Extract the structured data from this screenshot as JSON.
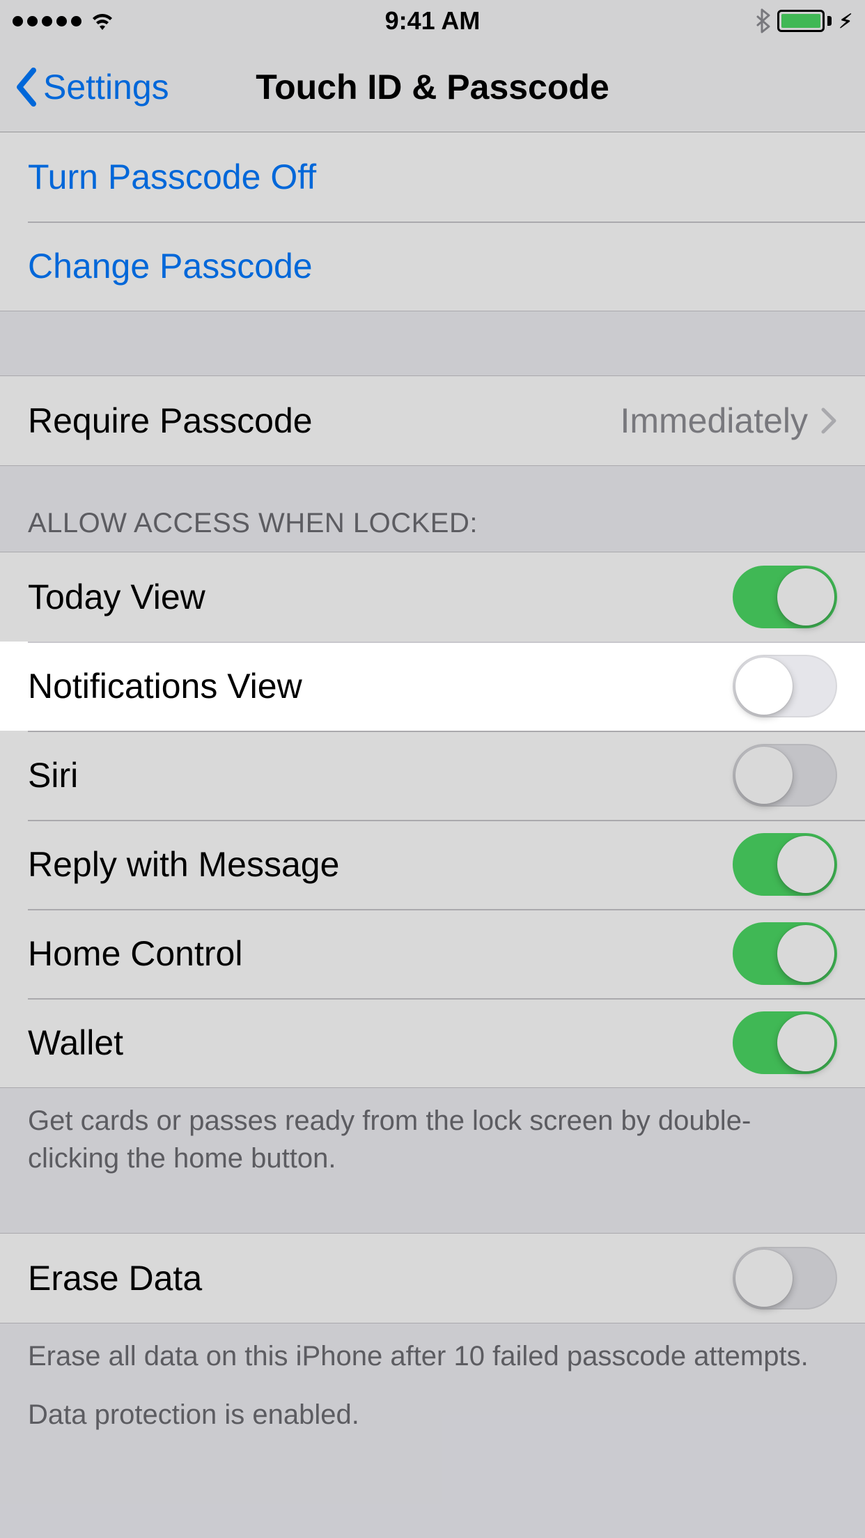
{
  "status": {
    "time": "9:41 AM"
  },
  "nav": {
    "back": "Settings",
    "title": "Touch ID & Passcode"
  },
  "passcode_actions": {
    "turn_off": "Turn Passcode Off",
    "change": "Change Passcode"
  },
  "require": {
    "label": "Require Passcode",
    "value": "Immediately"
  },
  "access": {
    "header": "ALLOW ACCESS WHEN LOCKED:",
    "items": [
      {
        "label": "Today View",
        "on": true
      },
      {
        "label": "Notifications View",
        "on": false,
        "highlighted": true
      },
      {
        "label": "Siri",
        "on": false
      },
      {
        "label": "Reply with Message",
        "on": true
      },
      {
        "label": "Home Control",
        "on": true
      },
      {
        "label": "Wallet",
        "on": true
      }
    ],
    "footer": "Get cards or passes ready from the lock screen by double-clicking the home button."
  },
  "erase": {
    "label": "Erase Data",
    "on": false,
    "footer1": "Erase all data on this iPhone after 10 failed passcode attempts.",
    "footer2": "Data protection is enabled."
  }
}
